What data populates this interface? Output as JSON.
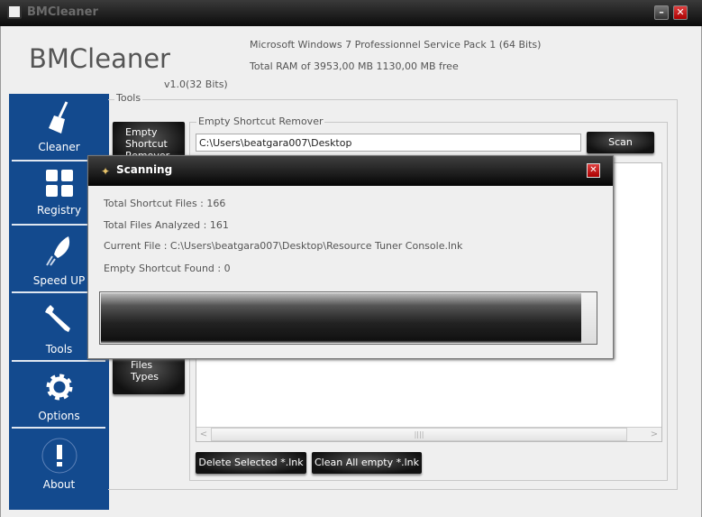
{
  "window": {
    "title": "BMCleaner",
    "minimize": "–",
    "close": "✕"
  },
  "header": {
    "logo": "BMCleaner",
    "version": "v1.0(32 Bits)",
    "os": "Microsoft Windows 7 Professionnel  Service Pack 1 (64 Bits)",
    "ram": "Total RAM of 3953,00 MB 1130,00 MB free"
  },
  "sidebar": {
    "items": [
      {
        "label": "Cleaner",
        "icon": "broom-icon"
      },
      {
        "label": "Registry",
        "icon": "grid-icon"
      },
      {
        "label": "Speed UP",
        "icon": "rocket-icon"
      },
      {
        "label": "Tools",
        "icon": "wrench-icon"
      },
      {
        "label": "Options",
        "icon": "gear-icon"
      },
      {
        "label": "About",
        "icon": "exclamation-icon"
      }
    ]
  },
  "tools": {
    "group_label": "Tools",
    "buttons": [
      {
        "label": "Empty Shortcut Remover"
      },
      {
        "label": "Files Types"
      }
    ]
  },
  "esr": {
    "group_label": "Empty Shortcut Remover",
    "path": "C:\\Users\\beatgara007\\Desktop",
    "scan": "Scan",
    "delete_selected": "Delete Selected *.lnk",
    "clean_all": "Clean All empty *.lnk"
  },
  "dialog": {
    "title": "Scanning",
    "close": "✕",
    "total_shortcut": "Total Shortcut Files :   166",
    "total_analyzed": "Total Files Analyzed :  161",
    "current_file": "Current File :  C:\\Users\\beatgara007\\Desktop\\Resource Tuner Console.lnk",
    "empty_found": "Empty Shortcut Found : 0",
    "progress_percent": 97
  },
  "colors": {
    "sidebar": "#134a8e",
    "titlebar": "#0b0b0b",
    "close": "#c00000"
  }
}
